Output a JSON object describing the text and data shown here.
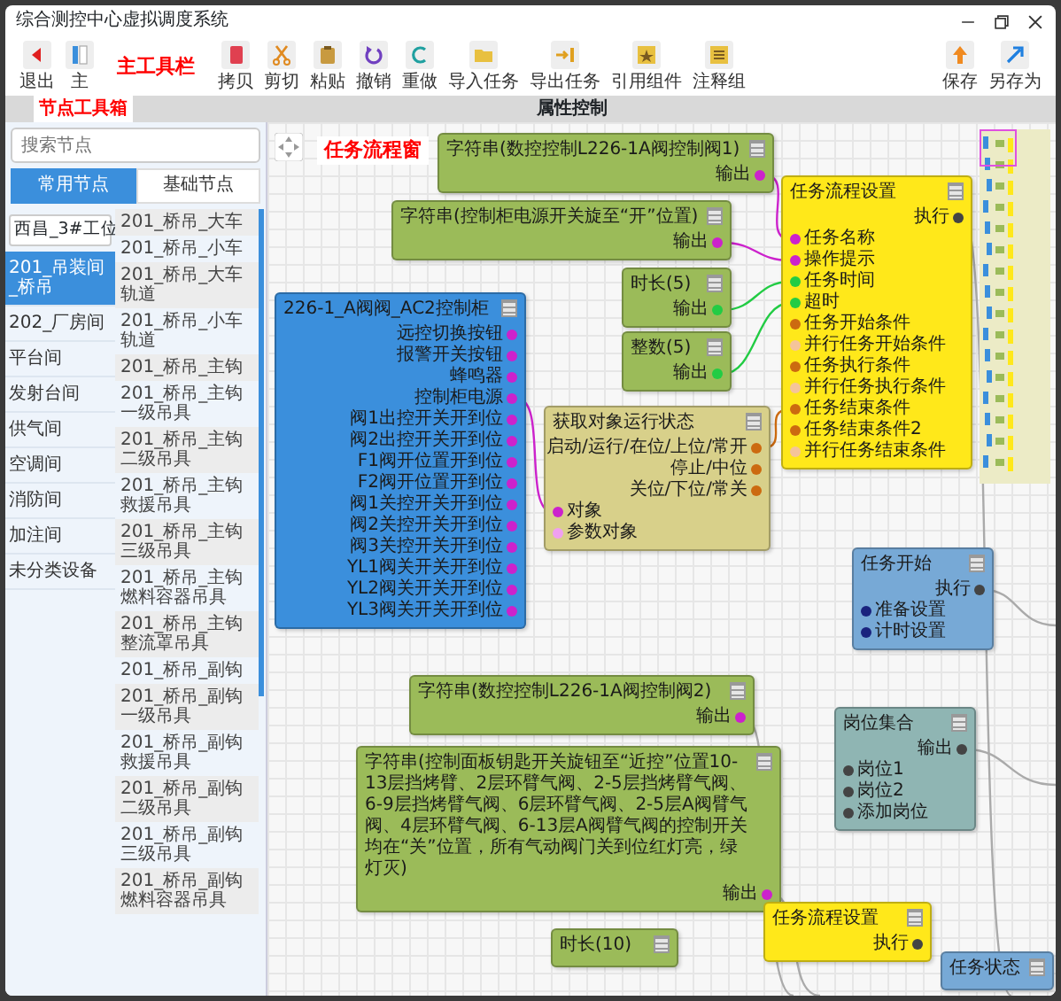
{
  "window": {
    "title": "综合测控中心虚拟调度系统"
  },
  "toolbar": {
    "label": "主工具栏",
    "left": [
      {
        "label": "退出"
      },
      {
        "label": "主"
      }
    ],
    "main": [
      {
        "label": "拷贝"
      },
      {
        "label": "剪切"
      },
      {
        "label": "粘贴"
      },
      {
        "label": "撤销"
      },
      {
        "label": "重做"
      },
      {
        "label": "导入任务"
      },
      {
        "label": "导出任务"
      },
      {
        "label": "引用组件"
      },
      {
        "label": "注释组"
      }
    ],
    "right": [
      {
        "label": "保存"
      },
      {
        "label": "另存为"
      }
    ]
  },
  "band": {
    "toolbox_label": "节点工具箱",
    "title": "属性控制"
  },
  "sidebar": {
    "search": {
      "placeholder": "搜索节点"
    },
    "tabs": [
      {
        "label": "常用节点",
        "selected": true
      },
      {
        "label": "基础节点",
        "selected": false
      }
    ],
    "site": "西昌_3#工位",
    "categories": [
      {
        "label": "201_吊装间_桥吊",
        "selected": true
      },
      {
        "label": "202_厂房间",
        "selected": false
      },
      {
        "label": "平台间",
        "selected": false
      },
      {
        "label": "发射台间",
        "selected": false
      },
      {
        "label": "供气间",
        "selected": false
      },
      {
        "label": "空调间",
        "selected": false
      },
      {
        "label": "消防间",
        "selected": false
      },
      {
        "label": "加注间",
        "selected": false
      },
      {
        "label": "未分类设备",
        "selected": false
      }
    ],
    "components": [
      "201_桥吊_大车",
      "201_桥吊_小车",
      "201_桥吊_大车轨道",
      "201_桥吊_小车轨道",
      "201_桥吊_主钩",
      "201_桥吊_主钩一级吊具",
      "201_桥吊_主钩二级吊具",
      "201_桥吊_主钩救援吊具",
      "201_桥吊_主钩三级吊具",
      "201_桥吊_主钩燃料容器吊具",
      "201_桥吊_主钩整流罩吊具",
      "201_桥吊_副钩",
      "201_桥吊_副钩一级吊具",
      "201_桥吊_副钩救援吊具",
      "201_桥吊_副钩二级吊具",
      "201_桥吊_副钩三级吊具",
      "201_桥吊_副钩燃料容器吊具"
    ]
  },
  "canvas": {
    "label": "任务流程窗",
    "nodes": [
      {
        "title": "字符串(数控控制L226-1A阀控制阀1)",
        "color": "#9bbb59",
        "outputs": [
          {
            "label": "输出",
            "color": "#cc22cc"
          }
        ]
      },
      {
        "title": "字符串(控制柜电源开关旋至“开”位置)",
        "color": "#9bbb59",
        "outputs": [
          {
            "label": "输出",
            "color": "#cc22cc"
          }
        ]
      },
      {
        "title": "时长(5)",
        "color": "#9bbb59",
        "outputs": [
          {
            "label": "输出",
            "color": "#22cc44"
          }
        ]
      },
      {
        "title": "整数(5)",
        "color": "#9bbb59",
        "outputs": [
          {
            "label": "输出",
            "color": "#22cc44"
          }
        ]
      },
      {
        "title": "226-1_A阀阀_AC2控制柜",
        "color": "#3b8fdc",
        "outputs": [
          {
            "label": "远控切换按钮",
            "color": "#cc22cc"
          },
          {
            "label": "报警开关按钮",
            "color": "#cc22cc"
          },
          {
            "label": "蜂鸣器",
            "color": "#cc22cc"
          },
          {
            "label": "控制柜电源",
            "color": "#cc22cc"
          },
          {
            "label": "阀1出控开关开到位",
            "color": "#cc22cc"
          },
          {
            "label": "阀2出控开关开到位",
            "color": "#cc22cc"
          },
          {
            "label": "F1阀开位置开到位",
            "color": "#cc22cc"
          },
          {
            "label": "F2阀开位置开到位",
            "color": "#cc22cc"
          },
          {
            "label": "阀1关控开关开到位",
            "color": "#cc22cc"
          },
          {
            "label": "阀2关控开关开到位",
            "color": "#cc22cc"
          },
          {
            "label": "阀3关控开关开到位",
            "color": "#cc22cc"
          },
          {
            "label": "YL1阀关开关开到位",
            "color": "#cc22cc"
          },
          {
            "label": "YL2阀关开关开到位",
            "color": "#cc22cc"
          },
          {
            "label": "YL3阀关开关开到位",
            "color": "#cc22cc"
          }
        ]
      },
      {
        "title": "任务流程设置",
        "color": "#ffe81a",
        "outputs": [
          {
            "label": "执行",
            "color": "#444444"
          }
        ],
        "inputs": [
          {
            "label": "任务名称",
            "color": "#cc22cc"
          },
          {
            "label": "操作提示",
            "color": "#cc22cc"
          },
          {
            "label": "任务时间",
            "color": "#22cc44"
          },
          {
            "label": "超时",
            "color": "#22cc44"
          },
          {
            "label": "任务开始条件",
            "color": "#cc6a10"
          },
          {
            "label": "并行任务开始条件",
            "color": "#f5c49a"
          },
          {
            "label": "任务执行条件",
            "color": "#cc6a10"
          },
          {
            "label": "并行任务执行条件",
            "color": "#f5c49a"
          },
          {
            "label": "任务结束条件",
            "color": "#cc6a10"
          },
          {
            "label": "任务结束条件2",
            "color": "#cc6a10"
          },
          {
            "label": "并行任务结束条件",
            "color": "#f5c49a"
          }
        ]
      },
      {
        "title": "获取对象运行状态",
        "color": "#d8d08a",
        "outputs": [
          {
            "label": "启动/运行/在位/上位/常开",
            "color": "#cc6a10"
          },
          {
            "label": "停止/中位",
            "color": "#cc6a10"
          },
          {
            "label": "关位/下位/常关",
            "color": "#cc6a10"
          }
        ],
        "inputs": [
          {
            "label": "对象",
            "color": "#cc22cc"
          },
          {
            "label": "参数对象",
            "color": "#f0a0f0"
          }
        ]
      },
      {
        "title": "任务开始",
        "color": "#77a9d6",
        "outputs": [
          {
            "label": "执行",
            "color": "#444444"
          }
        ],
        "inputs": [
          {
            "label": "准备设置",
            "color": "#1a237e"
          },
          {
            "label": "计时设置",
            "color": "#1a237e"
          }
        ]
      },
      {
        "title": "岗位集合",
        "color": "#8fb5b3",
        "outputs": [
          {
            "label": "输出",
            "color": "#444444"
          }
        ],
        "inputs": [
          {
            "label": "岗位1",
            "color": "#444444"
          },
          {
            "label": "岗位2",
            "color": "#444444"
          },
          {
            "label": "添加岗位",
            "color": "#444444"
          }
        ]
      },
      {
        "title": "字符串(数控控制L226-1A阀控制阀2)",
        "color": "#9bbb59",
        "outputs": [
          {
            "label": "输出",
            "color": "#cc22cc"
          }
        ]
      },
      {
        "title": "字符串(控制面板钥匙开关旋钮至“近控”位置10-13层挡烤臂、2层环臂气阀、2-5层挡烤臂气阀、6-9层挡烤臂气阀、6层环臂气阀、2-5层A阀臂气阀、4层环臂气阀、6-13层A阀臂气阀的控制开关均在“关”位置，所有气动阀门关到位红灯亮，绿灯灭)",
        "color": "#9bbb59",
        "outputs": [
          {
            "label": "输出",
            "color": "#cc22cc"
          }
        ]
      },
      {
        "title": "时长(10)",
        "color": "#9bbb59"
      },
      {
        "title": "任务流程设置",
        "color": "#ffe81a",
        "outputs": [
          {
            "label": "执行",
            "color": "#444444"
          }
        ]
      },
      {
        "title": "任务状态",
        "color": "#77a9d6"
      }
    ]
  }
}
